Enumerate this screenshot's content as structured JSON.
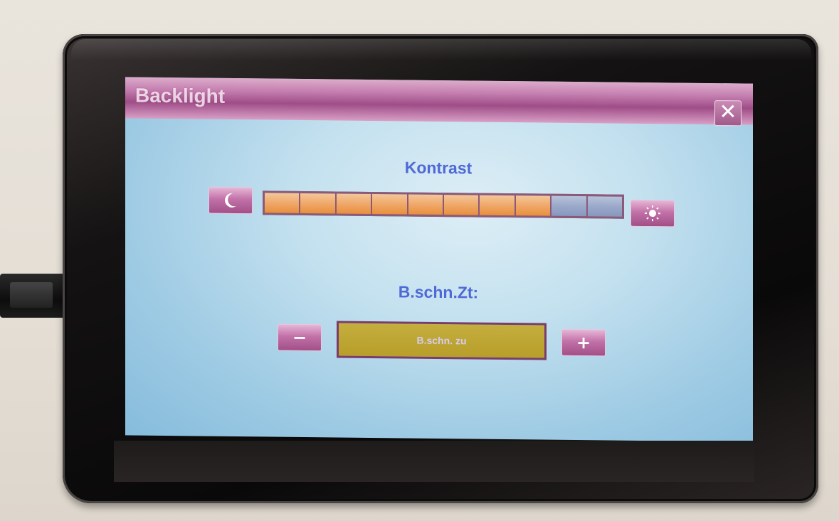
{
  "window": {
    "title": "Backlight",
    "close_glyph": "✕"
  },
  "contrast": {
    "label": "Kontrast",
    "level": 8,
    "max_level": 10,
    "decrease_icon": "moon-icon",
    "increase_icon": "sun-icon"
  },
  "timer": {
    "label": "B.schn.Zt:",
    "value": "B.schn. zu",
    "minus_glyph": "−",
    "plus_glyph": "+"
  },
  "colors": {
    "title_bar": "#b867a1",
    "label_text": "#4f6ad6",
    "bar_active": "#f0a86a",
    "bar_inactive": "#9aa9ca",
    "value_box": "#bea635"
  }
}
